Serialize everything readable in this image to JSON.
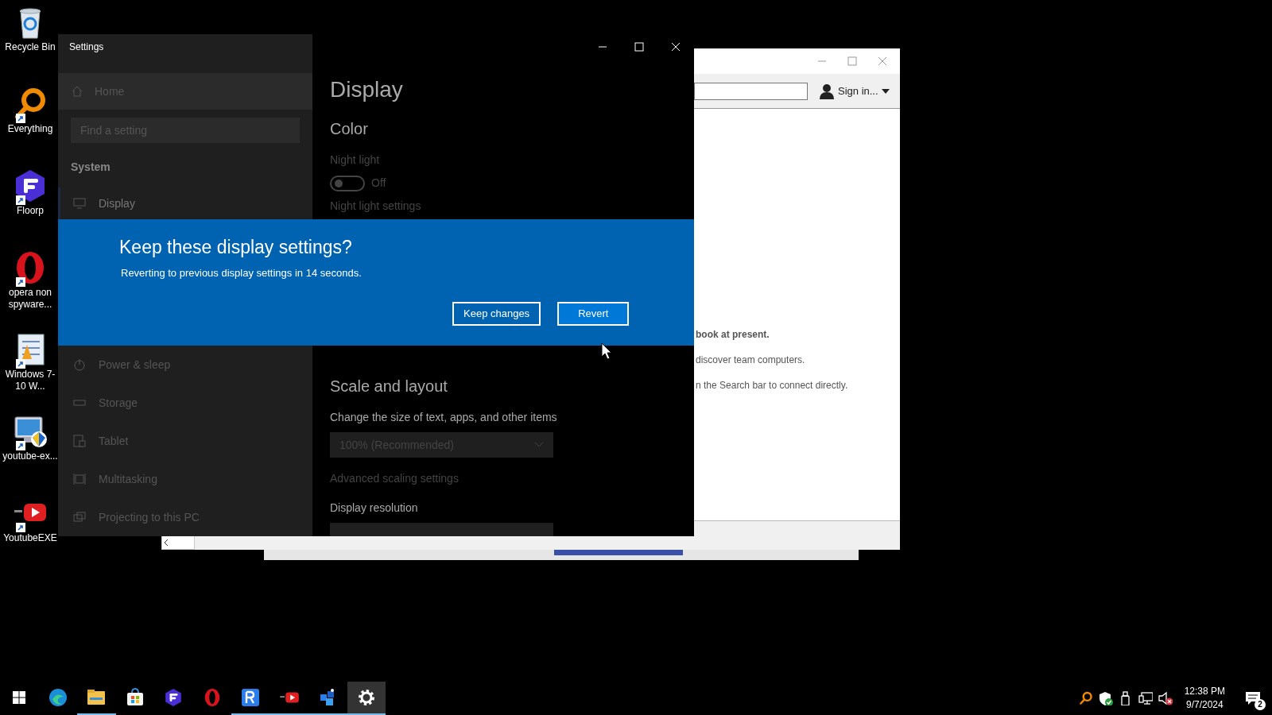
{
  "desktop_icons": [
    {
      "label": "Recycle Bin",
      "kind": "recycle",
      "shortcut": false
    },
    {
      "label": "Everything",
      "kind": "magnifier",
      "shortcut": true
    },
    {
      "label": "Floorp",
      "kind": "floorp",
      "shortcut": true
    },
    {
      "label": "opera non spyware...",
      "kind": "opera",
      "shortcut": true
    },
    {
      "label": "Windows 7-10 W...",
      "kind": "document",
      "shortcut": true
    },
    {
      "label": "youtube-ex...",
      "kind": "monitor",
      "shortcut": true
    },
    {
      "label": "YoutubeEXE",
      "kind": "youtube",
      "shortcut": true
    }
  ],
  "back_window": {
    "account": "Sign in...",
    "lines": [
      {
        "text": "book at present.",
        "bold": true
      },
      {
        "text": "discover team computers.",
        "bold": false
      },
      {
        "text": "n the Search bar to connect directly.",
        "bold": false
      }
    ]
  },
  "settings": {
    "title": "Settings",
    "sidebar_top": {
      "home": "Home",
      "search_placeholder": "Find a setting",
      "section": "System",
      "items": [
        {
          "label": "Display",
          "kind": "monitor",
          "selected": true
        }
      ]
    },
    "content_top": {
      "heading": "Display",
      "subheading": "Color",
      "night_light": {
        "label": "Night light",
        "on": false,
        "state_text": "Off"
      },
      "link": "Night light settings"
    },
    "dialog": {
      "title": "Keep these display settings?",
      "message": "Reverting to previous display settings in 14 seconds.",
      "buttons": [
        {
          "label": "Keep changes",
          "primary": false
        },
        {
          "label": "Revert",
          "primary": true
        }
      ]
    },
    "sidebar_bottom": {
      "items": [
        {
          "label": "Power & sleep",
          "kind": "power",
          "selected": false
        },
        {
          "label": "Storage",
          "kind": "storage",
          "selected": false
        },
        {
          "label": "Tablet",
          "kind": "tablet",
          "selected": false
        },
        {
          "label": "Multitasking",
          "kind": "multitask",
          "selected": false
        },
        {
          "label": "Projecting to this PC",
          "kind": "project",
          "selected": false
        }
      ]
    },
    "content_bottom": {
      "heading": "Scale and layout",
      "scale_label": "Change the size of text, apps, and other items",
      "scale_value": "100% (Recommended)",
      "link": "Advanced scaling settings",
      "resolution_label": "Display resolution"
    }
  },
  "taskbar": {
    "items": [
      {
        "kind": "start",
        "running": false,
        "active": false
      },
      {
        "kind": "edge",
        "running": false,
        "active": false
      },
      {
        "kind": "folder",
        "running": true,
        "active": false
      },
      {
        "kind": "store",
        "running": false,
        "active": false
      },
      {
        "kind": "floorp",
        "running": false,
        "active": false
      },
      {
        "kind": "opera",
        "running": false,
        "active": false
      },
      {
        "kind": "rapp",
        "running": true,
        "active": false
      },
      {
        "kind": "youtube",
        "running": true,
        "active": false
      },
      {
        "kind": "bluebox",
        "running": true,
        "active": false
      },
      {
        "kind": "gear",
        "running": true,
        "active": true
      }
    ],
    "tray": [
      {
        "kind": "magnifier"
      },
      {
        "kind": "shield"
      },
      {
        "kind": "usb"
      },
      {
        "kind": "network"
      },
      {
        "kind": "volume"
      }
    ],
    "time": "12:38 PM",
    "date": "9/7/2024",
    "notifications": "2"
  }
}
